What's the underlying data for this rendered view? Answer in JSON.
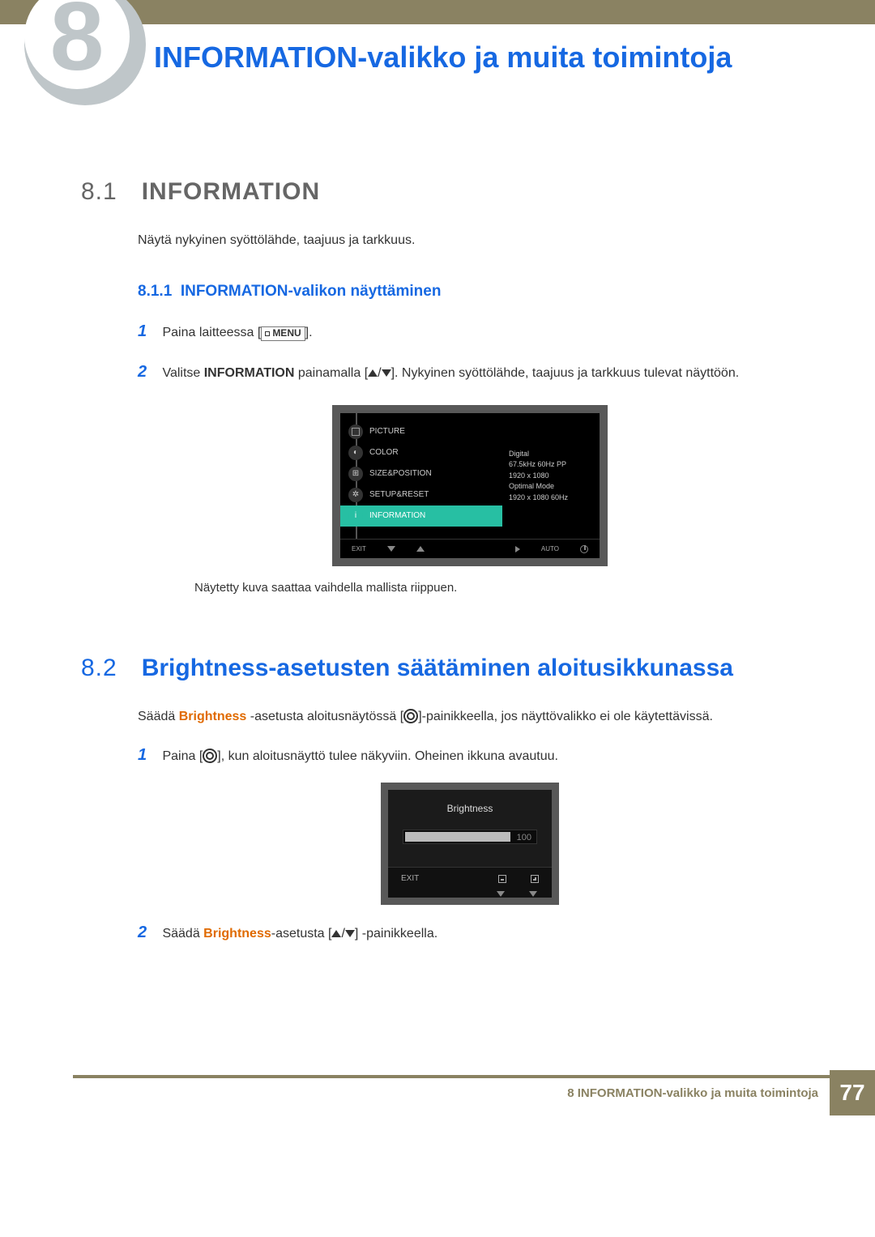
{
  "chapter_badge": "8",
  "chapter_title": "INFORMATION-valikko ja muita toimintoja",
  "sec81": {
    "num": "8.1",
    "title": "INFORMATION",
    "intro": "Näytä nykyinen syöttölähde, taajuus ja tarkkuus.",
    "sub_num": "8.1.1",
    "sub_title": "INFORMATION-valikon näyttäminen",
    "step1_before": "Paina laitteessa [",
    "step1_menu": "MENU",
    "step1_after": "].",
    "step2_a": "Valitse ",
    "step2_b": "INFORMATION",
    "step2_c": " painamalla [",
    "step2_d": "]. Nykyinen syöttölähde, taajuus ja tarkkuus tulevat näyttöön.",
    "caption": "Näytetty kuva saattaa vaihdella mallista riippuen."
  },
  "osd1": {
    "items": [
      "PICTURE",
      "COLOR",
      "SIZE&POSITION",
      "SETUP&RESET",
      "INFORMATION"
    ],
    "info_lines": [
      "Digital",
      "67.5kHz 60Hz PP",
      "1920 x 1080",
      "",
      "Optimal Mode",
      "1920 x 1080 60Hz"
    ],
    "exit": "EXIT",
    "auto": "AUTO"
  },
  "sec82": {
    "num": "8.2",
    "title": "Brightness-asetusten säätäminen aloitusikkunassa",
    "intro_a": "Säädä ",
    "intro_b": "Brightness",
    "intro_c": " -asetusta aloitusnäytössä [",
    "intro_d": "]-painikkeella, jos näyttövalikko ei ole käytettävissä.",
    "step1_a": "Paina [",
    "step1_b": "], kun aloitusnäyttö tulee näkyviin. Oheinen ikkuna avautuu.",
    "step2_a": "Säädä ",
    "step2_b": "Brightness",
    "step2_c": "-asetusta [",
    "step2_d": "] -painikkeella."
  },
  "osd2": {
    "title": "Brightness",
    "value": "100",
    "exit": "EXIT"
  },
  "footer": {
    "text": "8 INFORMATION-valikko ja muita toimintoja",
    "page": "77"
  }
}
